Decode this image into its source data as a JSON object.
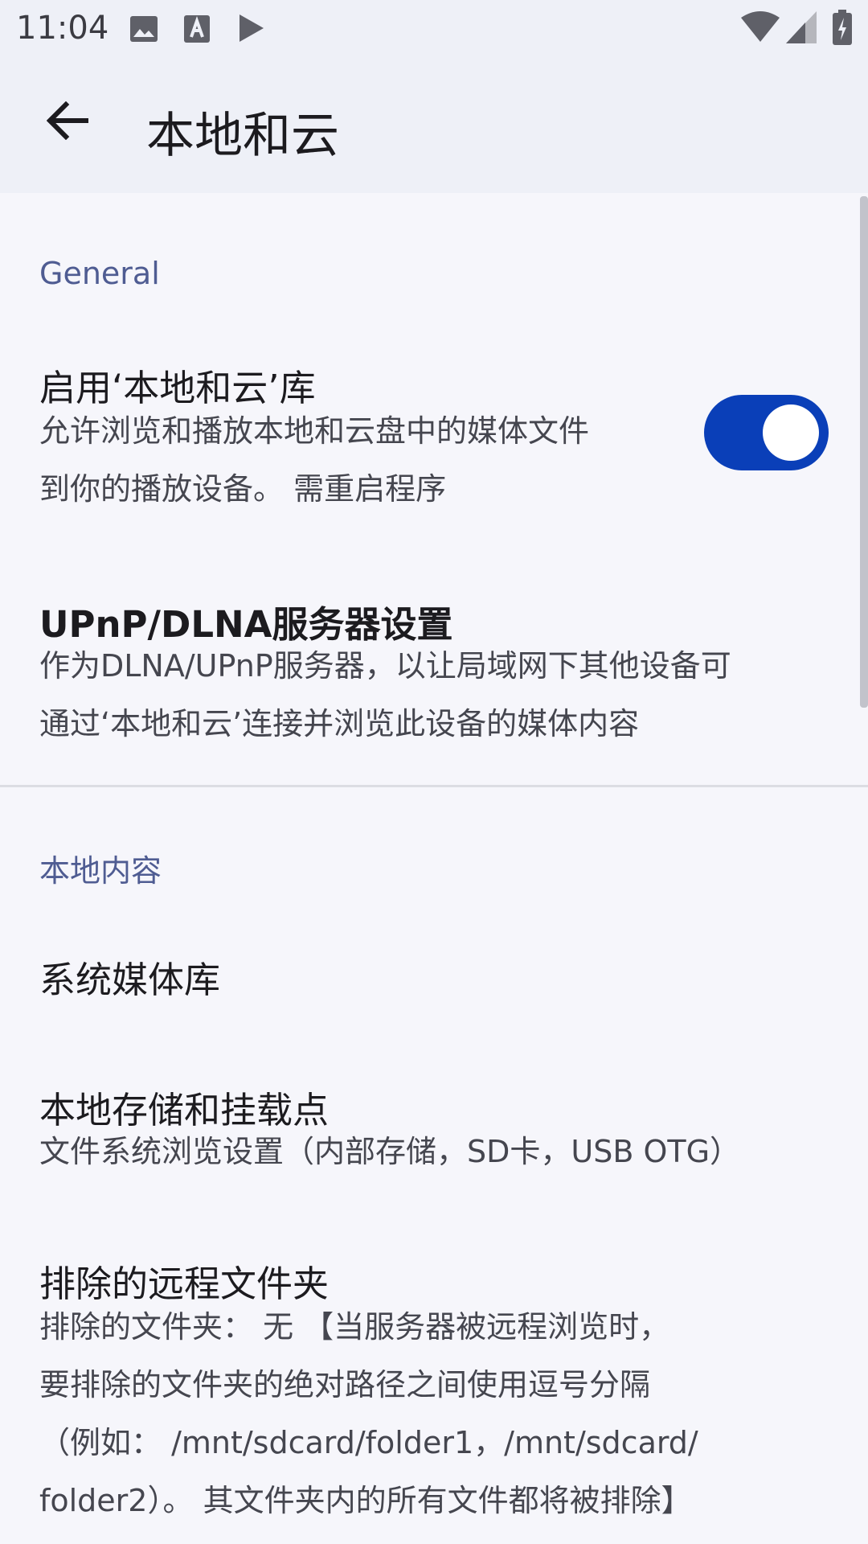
{
  "status_bar": {
    "time": "11:04",
    "left_icons": [
      "image-icon",
      "font-download-icon",
      "play-store-icon"
    ],
    "right_icons": [
      "wifi-icon",
      "signal-icon",
      "battery-charging-icon"
    ]
  },
  "app_bar": {
    "back_icon": "arrow-back-icon",
    "title": "本地和云"
  },
  "sections": {
    "general": {
      "header": "General",
      "enable_library": {
        "title": "启用‘本地和云’库",
        "summary_line1": "允许浏览和播放本地和云盘中的媒体文件",
        "summary_line2": "到你的播放设备。 需重启程序",
        "switch_on": true
      },
      "upnp_server": {
        "title": "UPnP/DLNA服务器设置",
        "summary_line1": "作为DLNA/UPnP服务器，以让局域网下其他设备可",
        "summary_line2": "通过‘本地和云’连接并浏览此设备的媒体内容"
      }
    },
    "local_content": {
      "header": "本地内容",
      "media_library": {
        "title": "系统媒体库"
      },
      "local_storage": {
        "title": "本地存储和挂载点",
        "summary": "文件系统浏览设置（内部存储，SD卡，USB OTG）"
      },
      "excluded_folders": {
        "title": "排除的远程文件夹",
        "summary_line1": "排除的文件夹： 无 【当服务器被远程浏览时，",
        "summary_line2": "要排除的文件夹的绝对路径之间使用逗号分隔",
        "summary_line3": "（例如： /mnt/sdcard/folder1，/mnt/sdcard/",
        "summary_line4": "folder2）。 其文件夹内的所有文件都将被排除】"
      }
    }
  },
  "colors": {
    "accent": "#0a3fb8",
    "section_header": "#4f5c92",
    "background": "#f6f6fb",
    "app_bar": "#eef0f7"
  }
}
